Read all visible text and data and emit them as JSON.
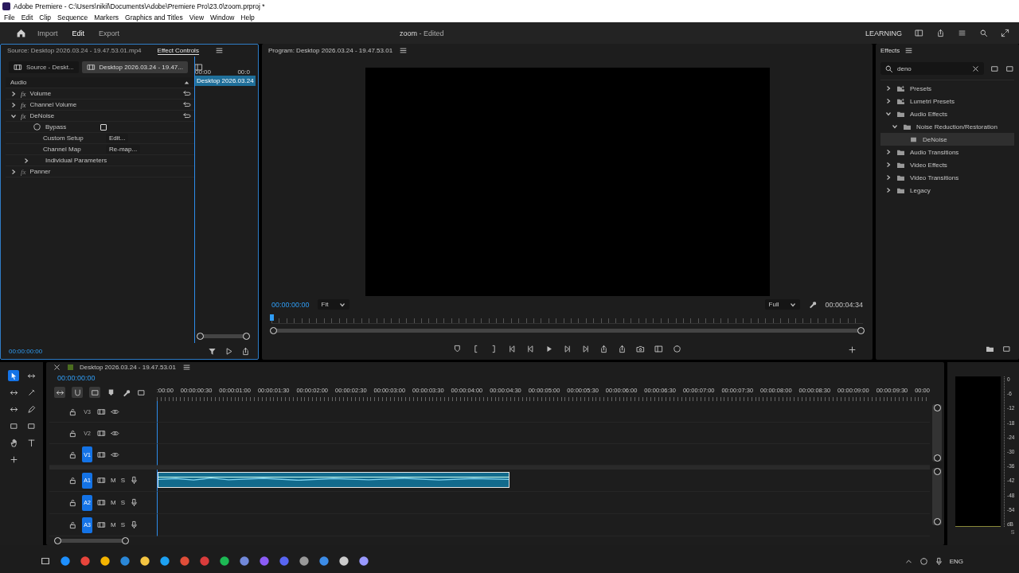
{
  "title_bar": {
    "title": "Adobe Premiere - C:\\Users\\nikil\\Documents\\Adobe\\Premiere Pro\\23.0\\zoom.prproj *"
  },
  "menu": [
    "File",
    "Edit",
    "Clip",
    "Sequence",
    "Markers",
    "Graphics and Titles",
    "View",
    "Window",
    "Help"
  ],
  "header": {
    "tabs": [
      {
        "label": "Import",
        "selected": false
      },
      {
        "label": "Edit",
        "selected": true
      },
      {
        "label": "Export",
        "selected": false
      }
    ],
    "project": "zoom",
    "status": "- Edited",
    "learning": "LEARNING"
  },
  "effect_controls": {
    "tabs": [
      {
        "label": "Source: Desktop 2026.03.24 - 19.47.53.01.mp4",
        "selected": false
      },
      {
        "label": "Effect Controls",
        "selected": true
      }
    ],
    "clip_tabs": [
      {
        "label": "Source - Deskt...",
        "selected": false
      },
      {
        "label": "Desktop 2026.03.24 - 19.47...",
        "selected": true
      }
    ],
    "ruler": [
      "00:00",
      "00:0"
    ],
    "clip": "Desktop 2026.03.24",
    "section": "Audio",
    "effects": [
      {
        "fx": "fx",
        "name": "Volume",
        "expanded": false,
        "enabled": true
      },
      {
        "fx": "fx",
        "name": "Channel Volume",
        "expanded": false,
        "enabled": true
      },
      {
        "fx": "fx",
        "name": "DeNoise",
        "expanded": true,
        "enabled": true,
        "params": [
          {
            "kind": "checkbox",
            "label": "Bypass",
            "checked": false
          },
          {
            "kind": "button",
            "label": "Custom Setup",
            "value": "Edit..."
          },
          {
            "kind": "button",
            "label": "Channel Map",
            "value": "Re-map..."
          },
          {
            "kind": "group",
            "label": "Individual Parameters",
            "expanded": false
          }
        ]
      },
      {
        "fx": "fx",
        "name": "Panner",
        "expanded": false,
        "enabled": false
      }
    ],
    "timecode": "00:00:00:00"
  },
  "program": {
    "title": "Program: Desktop 2026.03.24 - 19.47.53.01",
    "timecode": "00:00:00:00",
    "zoom": "Fit",
    "quality": "Full",
    "duration": "00:00:04:34"
  },
  "effects_panel": {
    "title": "Effects",
    "search": "deno",
    "tree": [
      {
        "label": "Presets",
        "kind": "preset",
        "expanded": false,
        "selected": false
      },
      {
        "label": "Lumetri Presets",
        "kind": "preset",
        "expanded": false,
        "selected": false
      },
      {
        "label": "Audio Effects",
        "kind": "folder",
        "expanded": true,
        "selected": false,
        "children": [
          {
            "label": "Noise Reduction/Restoration",
            "kind": "folder",
            "expanded": true,
            "selected": false,
            "children": [
              {
                "label": "DeNoise",
                "kind": "effect",
                "selected": true
              }
            ]
          }
        ]
      },
      {
        "label": "Audio Transitions",
        "kind": "folder",
        "expanded": false,
        "selected": false
      },
      {
        "label": "Video Effects",
        "kind": "folder",
        "expanded": false,
        "selected": false
      },
      {
        "label": "Video Transitions",
        "kind": "folder",
        "expanded": false,
        "selected": false
      },
      {
        "label": "Legacy",
        "kind": "folder",
        "expanded": false,
        "selected": false
      }
    ]
  },
  "timeline": {
    "title": "Desktop 2026.03.24 - 19.47.53.01",
    "timecode": "00:00:00:00",
    "ruler": [
      ":00:00",
      "00:00:00:30",
      "00:00:01:00",
      "00:00:01:30",
      "00:00:02:00",
      "00:00:02:30",
      "00:00:03:00",
      "00:00:03:30",
      "00:00:04:00",
      "00:00:04:30",
      "00:00:05:00",
      "00:00:05:30",
      "00:00:06:00",
      "00:00:06:30",
      "00:00:07:00",
      "00:00:07:30",
      "00:00:08:00",
      "00:00:08:30",
      "00:00:09:00",
      "00:00:09:30",
      "00:00"
    ],
    "video_tracks": [
      {
        "name": "V3",
        "targeted": false
      },
      {
        "name": "V2",
        "targeted": false
      },
      {
        "name": "V1",
        "targeted": true
      }
    ],
    "audio_tracks": [
      {
        "name": "A1",
        "targeted": true,
        "mute": "M",
        "solo": "S",
        "has_clip": true
      },
      {
        "name": "A2",
        "targeted": true,
        "mute": "M",
        "solo": "S",
        "has_clip": false
      },
      {
        "name": "A3",
        "targeted": true,
        "mute": "M",
        "solo": "S",
        "has_clip": false
      }
    ]
  },
  "meters": {
    "scale": [
      "0",
      "-6",
      "-12",
      "-18",
      "-24",
      "-30",
      "-36",
      "-42",
      "-48",
      "-54",
      "dB"
    ],
    "solo": "S"
  },
  "taskbar": {
    "language": "ENG"
  }
}
